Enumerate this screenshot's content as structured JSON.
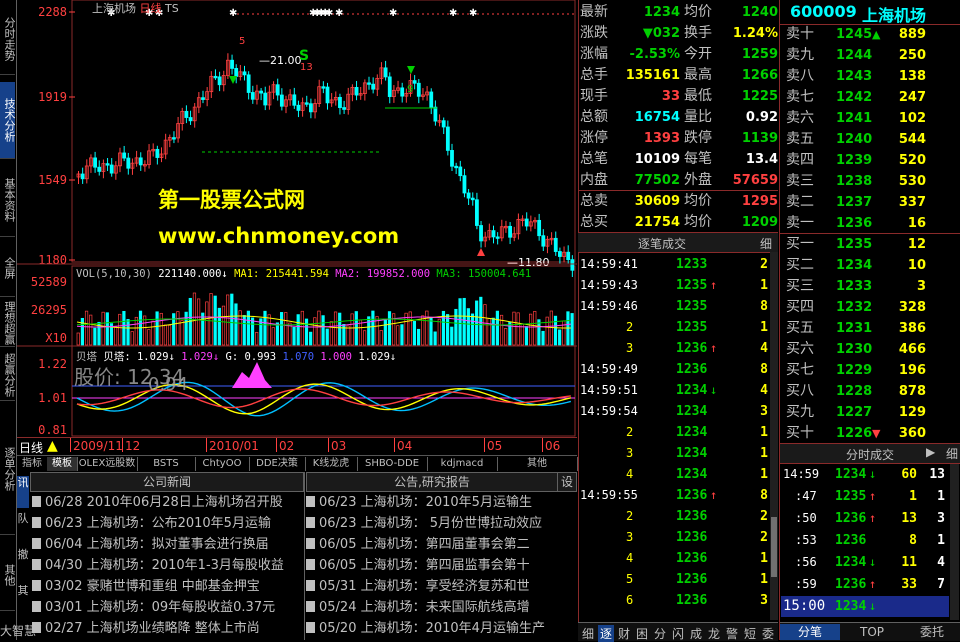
{
  "left_tabs": [
    "分时走势",
    "技术分析",
    "基本资料",
    "全屏",
    "理想超赢",
    "超赢分析",
    "逐单分析",
    "其他"
  ],
  "chart": {
    "title": "上海机场",
    "period": "日线",
    "mode": "TS",
    "price_axis": [
      "2288",
      "1919",
      "1549",
      "1180"
    ],
    "high_marker": "21.00",
    "low_marker": "11.80",
    "watermark_line1": "第一股票公式网",
    "watermark_line2": "www.chnmoney.com",
    "vol_header": {
      "label": "VOL(5,10,30)",
      "vol": "221140.000↓",
      "ma1_label": "MA1:",
      "ma1": "215441.594",
      "ma2_label": "MA2:",
      "ma2": "199852.000",
      "ma3_label": "MA3:",
      "ma3": "150004.641"
    },
    "vol_axis": [
      "52589",
      "26295",
      "X10"
    ],
    "ind_header": {
      "name": "贝塔",
      "val1_label": "贝塔:",
      "val1": "1.029↓",
      "val2": "1.029↓",
      "g_label": "G:",
      "g": "0.993",
      "v3": "1.070",
      "v4": "1.000",
      "v5": "1.029↓"
    },
    "ind_axis": [
      "1.22",
      "1.01",
      "0.81"
    ],
    "ind_overlay_1": "股价: 12.34",
    "ind_overlay_2": "0.94",
    "period_label": "日线",
    "date_axis": [
      "2009/11",
      "12",
      "2010/01",
      "02",
      "03",
      "04",
      "05",
      "06"
    ],
    "markers": {
      "s1": "S",
      "num1": "5",
      "num13": "13",
      "num9": "9"
    }
  },
  "bottom_tabs": [
    "指标",
    "模板",
    "OLEX远股数",
    "BSTS",
    "ChtyOO",
    "DDE决策",
    "K线龙虎",
    "SHBO-DDE",
    "kdjmacd",
    "其他"
  ],
  "news": {
    "left_header": "公司新闻",
    "right_header": "公告,研究报告",
    "left_side_tabs": [
      "讯",
      "队",
      "撤",
      "其"
    ],
    "left_rows": [
      "06/28 2010年06月28日上海机场召开股",
      "06/23 上海机场：公布2010年5月运输",
      "06/04 上海机场：拟对董事会进行换届",
      "04/30 上海机场：2010年1-3月每股收益",
      "03/02 豪赌世博和重组 中邮基金押宝",
      "03/01 上海机场：09年每股收益0.37元",
      "02/27 上海机场业绩略降 整体上市尚"
    ],
    "right_rows": [
      "06/23 上海机场：2010年5月运输生",
      "06/23 上海机场：  5月份世博拉动效应",
      "06/05 上海机场：第四届董事会第二",
      "06/05 上海机场：第四届监事会第十",
      "05/31 上海机场：享受经济复苏和世",
      "05/24 上海机场：未来国际航线高增",
      "05/20 上海机场：2010年4月运输生产"
    ],
    "settings_label": "设"
  },
  "quote": {
    "left": [
      {
        "label": "最新",
        "value": "1234",
        "color": "green"
      },
      {
        "label": "涨跌",
        "value": "▼032",
        "color": "green"
      },
      {
        "label": "涨幅",
        "value": "-2.53%",
        "color": "green"
      },
      {
        "label": "总手",
        "value": "135161",
        "color": "yellow"
      },
      {
        "label": "现手",
        "value": "33",
        "color": "red"
      },
      {
        "label": "总额",
        "value": "16754",
        "color": "cyan"
      },
      {
        "label": "涨停",
        "value": "1393",
        "color": "red"
      },
      {
        "label": "总笔",
        "value": "10109",
        "color": "white"
      },
      {
        "label": "内盘",
        "value": "77502",
        "color": "green"
      },
      {
        "label": "总卖",
        "value": "30609",
        "color": "yellow"
      },
      {
        "label": "总买",
        "value": "21754",
        "color": "yellow"
      }
    ],
    "right": [
      {
        "label": "均价",
        "value": "1240",
        "color": "green"
      },
      {
        "label": "换手",
        "value": "1.24%",
        "color": "yellow"
      },
      {
        "label": "今开",
        "value": "1259",
        "color": "green"
      },
      {
        "label": "最高",
        "value": "1266",
        "color": "green"
      },
      {
        "label": "最低",
        "value": "1225",
        "color": "green"
      },
      {
        "label": "量比",
        "value": "0.92",
        "color": "white"
      },
      {
        "label": "跌停",
        "value": "1139",
        "color": "green"
      },
      {
        "label": "每笔",
        "value": "13.4",
        "color": "white"
      },
      {
        "label": "外盘",
        "value": "57659",
        "color": "red"
      },
      {
        "label": "均价",
        "value": "1295",
        "color": "red"
      },
      {
        "label": "均价",
        "value": "1209",
        "color": "green"
      }
    ],
    "ticks_header": "逐笔成交",
    "ticks_header_btn": "细",
    "ticks": [
      {
        "time": "14:59:41",
        "price": "1233",
        "arrow": "",
        "vol": "2"
      },
      {
        "time": "14:59:43",
        "price": "1235",
        "arrow": "↑",
        "vol": "1"
      },
      {
        "time": "14:59:46",
        "price": "1235",
        "arrow": "",
        "vol": "8"
      },
      {
        "time": "2",
        "price": "1235",
        "arrow": "",
        "vol": "1"
      },
      {
        "time": "3",
        "price": "1236",
        "arrow": "↑",
        "vol": "4"
      },
      {
        "time": "14:59:49",
        "price": "1236",
        "arrow": "",
        "vol": "8"
      },
      {
        "time": "14:59:51",
        "price": "1234",
        "arrow": "↓",
        "vol": "4"
      },
      {
        "time": "14:59:54",
        "price": "1234",
        "arrow": "",
        "vol": "3"
      },
      {
        "time": "2",
        "price": "1234",
        "arrow": "",
        "vol": "1"
      },
      {
        "time": "3",
        "price": "1234",
        "arrow": "",
        "vol": "1"
      },
      {
        "time": "4",
        "price": "1234",
        "arrow": "",
        "vol": "1"
      },
      {
        "time": "14:59:55",
        "price": "1236",
        "arrow": "↑",
        "vol": "8"
      },
      {
        "time": "2",
        "price": "1236",
        "arrow": "",
        "vol": "2"
      },
      {
        "time": "3",
        "price": "1236",
        "arrow": "",
        "vol": "2"
      },
      {
        "time": "4",
        "price": "1236",
        "arrow": "",
        "vol": "1"
      },
      {
        "time": "5",
        "price": "1236",
        "arrow": "",
        "vol": "1"
      },
      {
        "time": "6",
        "price": "1236",
        "arrow": "",
        "vol": "3"
      }
    ],
    "ticks_tabs": [
      "细",
      "逐",
      "财",
      "困",
      "分",
      "闪",
      "成",
      "龙",
      "警",
      "短",
      "委"
    ]
  },
  "orderbook": {
    "code": "600009",
    "name": "上海机场",
    "asks": [
      {
        "label": "卖十",
        "price": "1245",
        "arrow": "▲",
        "vol": "889"
      },
      {
        "label": "卖九",
        "price": "1244",
        "arrow": "",
        "vol": "250"
      },
      {
        "label": "卖八",
        "price": "1243",
        "arrow": "",
        "vol": "138"
      },
      {
        "label": "卖七",
        "price": "1242",
        "arrow": "",
        "vol": "247"
      },
      {
        "label": "卖六",
        "price": "1241",
        "arrow": "",
        "vol": "102"
      },
      {
        "label": "卖五",
        "price": "1240",
        "arrow": "",
        "vol": "544"
      },
      {
        "label": "卖四",
        "price": "1239",
        "arrow": "",
        "vol": "520"
      },
      {
        "label": "卖三",
        "price": "1238",
        "arrow": "",
        "vol": "530"
      },
      {
        "label": "卖二",
        "price": "1237",
        "arrow": "",
        "vol": "337"
      },
      {
        "label": "卖一",
        "price": "1236",
        "arrow": "",
        "vol": "16"
      }
    ],
    "bids": [
      {
        "label": "买一",
        "price": "1235",
        "arrow": "",
        "vol": "12"
      },
      {
        "label": "买二",
        "price": "1234",
        "arrow": "",
        "vol": "10"
      },
      {
        "label": "买三",
        "price": "1233",
        "arrow": "",
        "vol": "3"
      },
      {
        "label": "买四",
        "price": "1232",
        "arrow": "",
        "vol": "328"
      },
      {
        "label": "买五",
        "price": "1231",
        "arrow": "",
        "vol": "386"
      },
      {
        "label": "买六",
        "price": "1230",
        "arrow": "",
        "vol": "466"
      },
      {
        "label": "买七",
        "price": "1229",
        "arrow": "",
        "vol": "196"
      },
      {
        "label": "买八",
        "price": "1228",
        "arrow": "",
        "vol": "878"
      },
      {
        "label": "买九",
        "price": "1227",
        "arrow": "",
        "vol": "129"
      },
      {
        "label": "买十",
        "price": "1226",
        "arrow": "▼",
        "vol": "360"
      }
    ],
    "min_header": "分时成交",
    "min_rows": [
      {
        "time": "14:59",
        "price": "1234",
        "arrow": "↓",
        "vol": "60",
        "n": "13"
      },
      {
        "time": ":47",
        "price": "1235",
        "arrow": "↑",
        "vol": "1",
        "n": "1"
      },
      {
        "time": ":50",
        "price": "1236",
        "arrow": "↑",
        "vol": "13",
        "n": "3"
      },
      {
        "time": ":53",
        "price": "1236",
        "arrow": "",
        "vol": "8",
        "n": "1"
      },
      {
        "time": ":56",
        "price": "1234",
        "arrow": "↓",
        "vol": "11",
        "n": "4"
      },
      {
        "time": ":59",
        "price": "1236",
        "arrow": "↑",
        "vol": "33",
        "n": "7"
      },
      {
        "time": "15:00",
        "price": "1234",
        "arrow": "↓",
        "vol": "",
        "n": ""
      }
    ],
    "bottom_tabs": [
      "分笔",
      "TOP",
      "委托"
    ]
  },
  "footer_label": "大智慧",
  "colors": {
    "up": "#ff4040",
    "down": "#00d000",
    "accent": "#16418a",
    "grid": "#8a2a2a"
  }
}
